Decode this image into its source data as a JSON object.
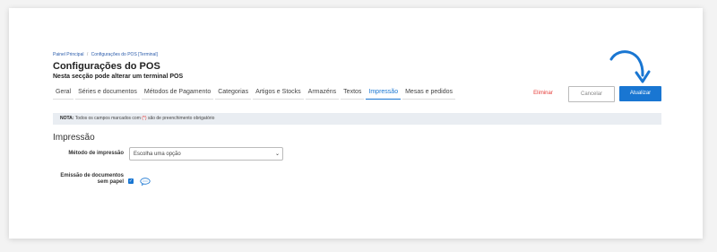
{
  "breadcrumb": {
    "home": "Painel Principal",
    "sep": "/",
    "current": "Configurações do POS [Terminal]"
  },
  "header": {
    "title": "Configurações do POS",
    "subtitle": "Nesta secção pode alterar um terminal POS"
  },
  "tabs": [
    {
      "label": "Geral"
    },
    {
      "label": "Séries e documentos"
    },
    {
      "label": "Métodos de Pagamento"
    },
    {
      "label": "Categorias"
    },
    {
      "label": "Artigos e Stocks"
    },
    {
      "label": "Armazéns"
    },
    {
      "label": "Textos"
    },
    {
      "label": "Impressão",
      "active": true
    },
    {
      "label": "Mesas e pedidos"
    }
  ],
  "actions": {
    "delete": "Eliminar",
    "cancel": "Cancelar",
    "update": "Atualizar"
  },
  "note": {
    "prefix": "NOTA:",
    "text_before": "Todos os campos marcados com",
    "star": "(*)",
    "text_after": "são de preenchimento obrigatório"
  },
  "section": {
    "title": "Impressão"
  },
  "fields": {
    "print_method": {
      "label": "Método de impressão",
      "value": "Escolha uma opção"
    },
    "paperless": {
      "label_line1": "Emissão de documentos",
      "label_line2": "sem papel",
      "checked": true
    }
  },
  "colors": {
    "accent": "#1976d2",
    "danger": "#e53935",
    "note_bg": "#e9edf2"
  }
}
